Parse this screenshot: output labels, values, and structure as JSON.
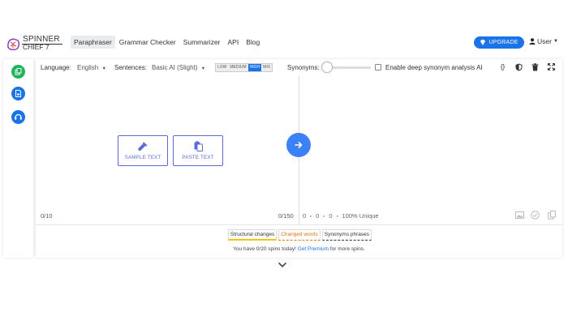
{
  "brand": {
    "line1": "SPINNER",
    "line2": "CHIEF 7"
  },
  "nav": {
    "items": [
      {
        "label": "Paraphraser",
        "active": true
      },
      {
        "label": "Grammar Checker",
        "active": false
      },
      {
        "label": "Summarizer",
        "active": false
      },
      {
        "label": "API",
        "active": false
      },
      {
        "label": "Blog",
        "active": false
      }
    ],
    "upgrade_label": "UPGRADE",
    "user_label": "User"
  },
  "toolbar": {
    "language_label": "Language:",
    "language_value": "English",
    "sentences_label": "Sentences:",
    "sentences_value": "Basic AI (Slight)",
    "levels": [
      {
        "label": "LOW",
        "active": false
      },
      {
        "label": "MEDIUM",
        "active": false
      },
      {
        "label": "HIGH",
        "active": true
      },
      {
        "label": "MIX",
        "active": false
      }
    ],
    "synonyms_label": "Synonyms:",
    "synonyms_level": 0,
    "deep_analysis_label": "Enable deep synonym analysis AI",
    "deep_analysis_checked": false,
    "json_icon_text": "{}"
  },
  "editor": {
    "sample_label": "SAMPLE TEXT",
    "paste_label": "PASTE TEXT",
    "input_counter": "0/10",
    "output_counter": "0/150",
    "stats": [
      "0",
      "0",
      "0",
      "100% Unique"
    ]
  },
  "legend": {
    "structural": "Structural changes",
    "changed": "Changed words",
    "synonyms": "Synonyms phrases"
  },
  "notice": {
    "prefix": "You have 0/20 spins today!",
    "link": "Get Premium",
    "suffix": "for more spins."
  },
  "colors": {
    "accent": "#1a73e8",
    "rail_green": "#22b35a",
    "rail_blue": "#1a73e8",
    "go_button": "#3b82f6",
    "card_border": "#5b6bd8",
    "changed_words": "#e8710a",
    "structural_underline": "#f4c20d"
  }
}
